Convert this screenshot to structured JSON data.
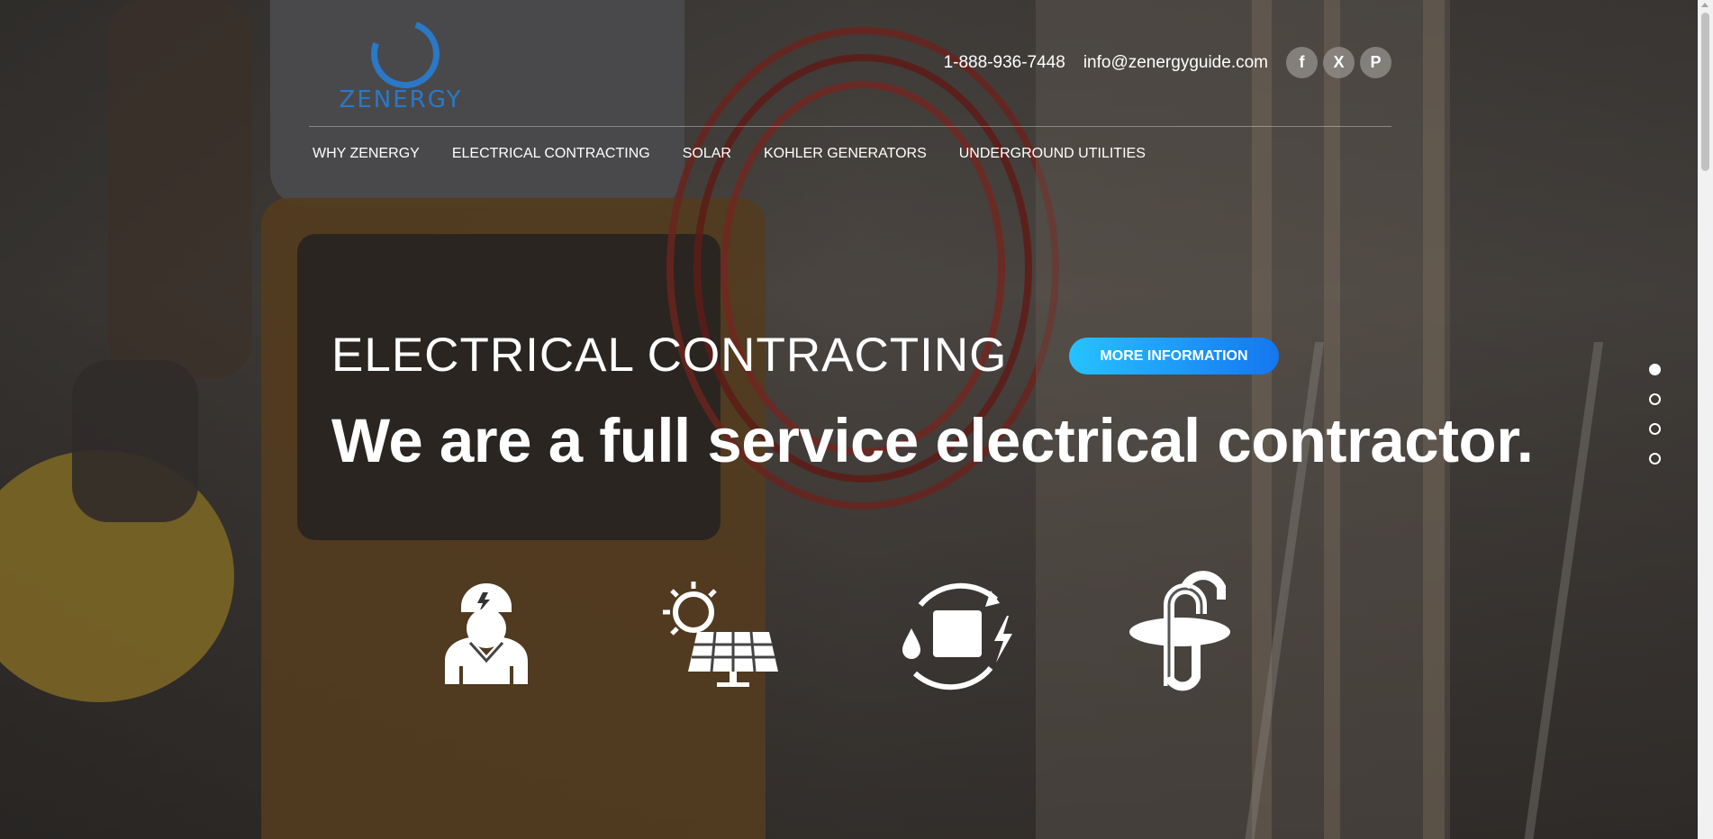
{
  "brand": {
    "name": "ZENERGY",
    "color": "#2a78c6"
  },
  "contact": {
    "phone": "1-888-936-7448",
    "email": "info@zenergyguide.com"
  },
  "social": [
    {
      "name": "facebook-icon",
      "glyph": "f"
    },
    {
      "name": "x-icon",
      "glyph": "X"
    },
    {
      "name": "pinterest-icon",
      "glyph": "P"
    }
  ],
  "nav": {
    "items": [
      {
        "label": "WHY ZENERGY"
      },
      {
        "label": "ELECTRICAL CONTRACTING"
      },
      {
        "label": "SOLAR"
      },
      {
        "label": "KOHLER GENERATORS"
      },
      {
        "label": "UNDERGROUND UTILITIES"
      }
    ]
  },
  "hero": {
    "kicker": "ELECTRICAL CONTRACTING",
    "cta_label": "MORE INFORMATION",
    "title": "We are a full service electrical contractor.",
    "cta_colors": [
      "#27c2ff",
      "#1576f0"
    ]
  },
  "services": [
    {
      "icon": "electrician-icon"
    },
    {
      "icon": "solar-panel-icon"
    },
    {
      "icon": "generator-cycle-icon"
    },
    {
      "icon": "underground-pipe-icon"
    }
  ],
  "slider": {
    "total": 4,
    "active": 1
  }
}
